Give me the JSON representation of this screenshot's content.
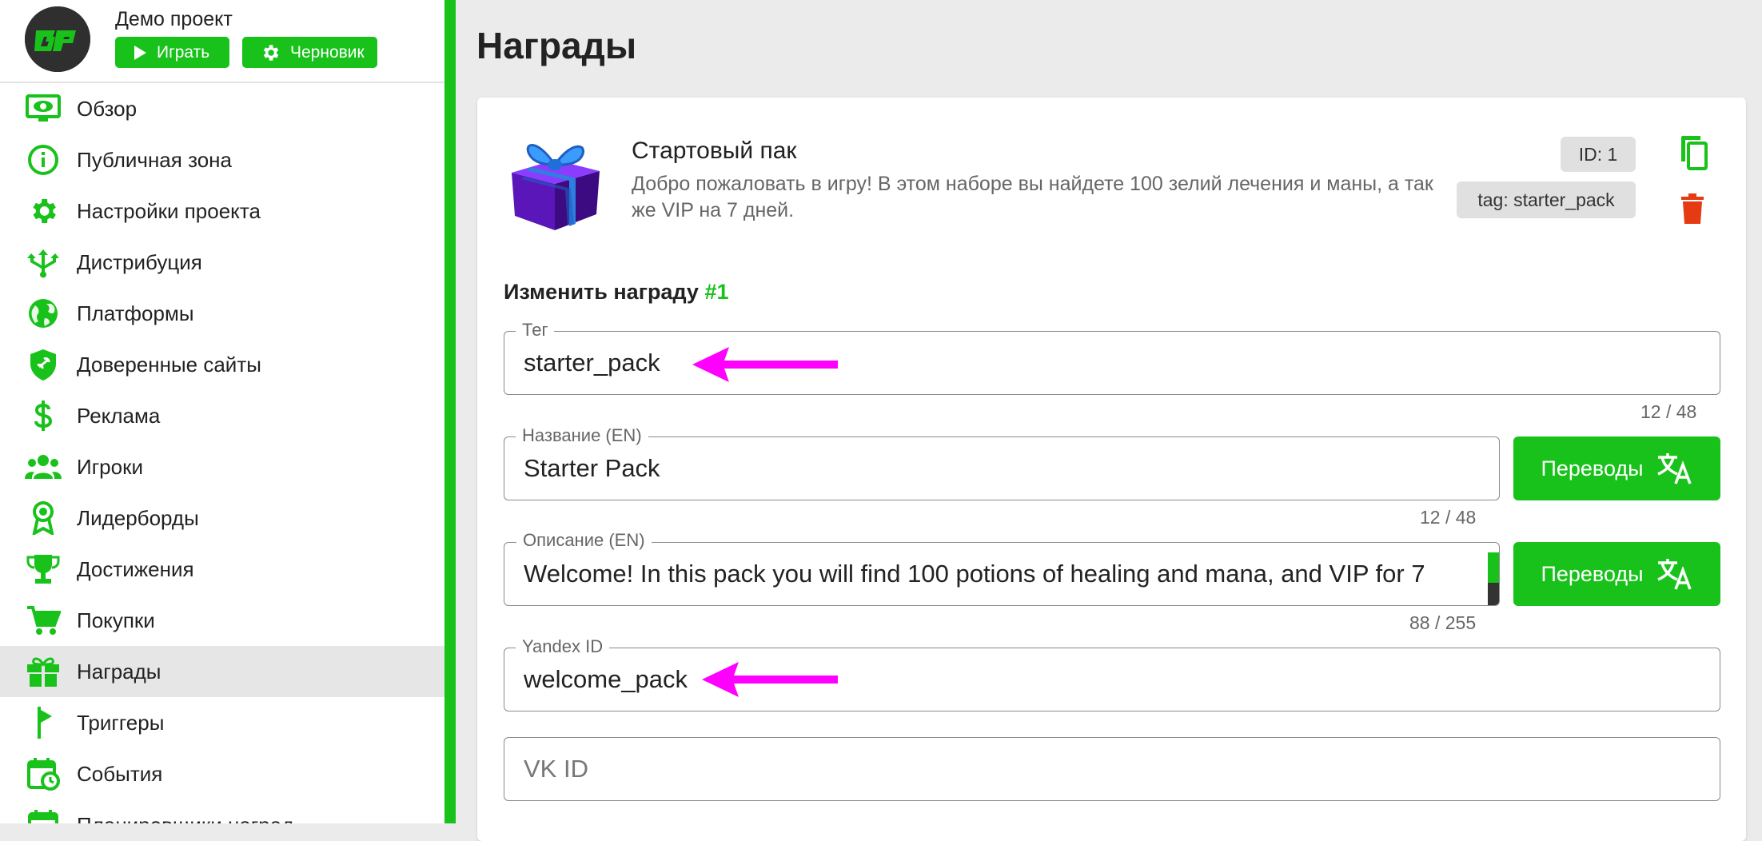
{
  "project": {
    "name": "Демо проект",
    "play_label": "Играть",
    "draft_label": "Черновик"
  },
  "sidebar": {
    "items": [
      {
        "label": "Обзор",
        "icon": "eye-icon"
      },
      {
        "label": "Публичная зона",
        "icon": "info-icon"
      },
      {
        "label": "Настройки проекта",
        "icon": "gear-icon"
      },
      {
        "label": "Дистрибуция",
        "icon": "distribution-icon"
      },
      {
        "label": "Платформы",
        "icon": "globe-icon"
      },
      {
        "label": "Доверенные сайты",
        "icon": "shield-link-icon"
      },
      {
        "label": "Реклама",
        "icon": "dollar-icon"
      },
      {
        "label": "Игроки",
        "icon": "group-icon"
      },
      {
        "label": "Лидерборды",
        "icon": "award-icon"
      },
      {
        "label": "Достижения",
        "icon": "trophy-icon"
      },
      {
        "label": "Покупки",
        "icon": "cart-icon"
      },
      {
        "label": "Награды",
        "icon": "gift-icon",
        "active": true
      },
      {
        "label": "Триггеры",
        "icon": "flag-icon"
      },
      {
        "label": "События",
        "icon": "calendar-clock-icon"
      },
      {
        "label": "Планировщики наград",
        "icon": "calendar-icon"
      }
    ]
  },
  "page": {
    "title": "Награды"
  },
  "reward": {
    "name": "Стартовый пак",
    "description": "Добро пожаловать в игру! В этом наборе вы найдете 100 зелий лечения и маны, а так же VIP на 7 дней.",
    "id_chip": "ID: 1",
    "tag_chip": "tag: starter_pack"
  },
  "edit": {
    "title": "Изменить награду",
    "number": "#1",
    "tag": {
      "label": "Тег",
      "value": "starter_pack",
      "counter": "12 / 48"
    },
    "name": {
      "label": "Название (EN)",
      "value": "Starter Pack",
      "counter": "12 / 48"
    },
    "description": {
      "label": "Описание (EN)",
      "value": "Welcome! In this pack you will find 100 potions of healing and mana, and VIP for 7",
      "counter": "88 / 255"
    },
    "yandex": {
      "label": "Yandex ID",
      "value": "welcome_pack"
    },
    "vk": {
      "placeholder": "VK ID"
    },
    "translations_label": "Переводы"
  },
  "colors": {
    "accent": "#18c21a",
    "delete": "#e53a12",
    "annotation_arrow": "#ff00ff"
  }
}
